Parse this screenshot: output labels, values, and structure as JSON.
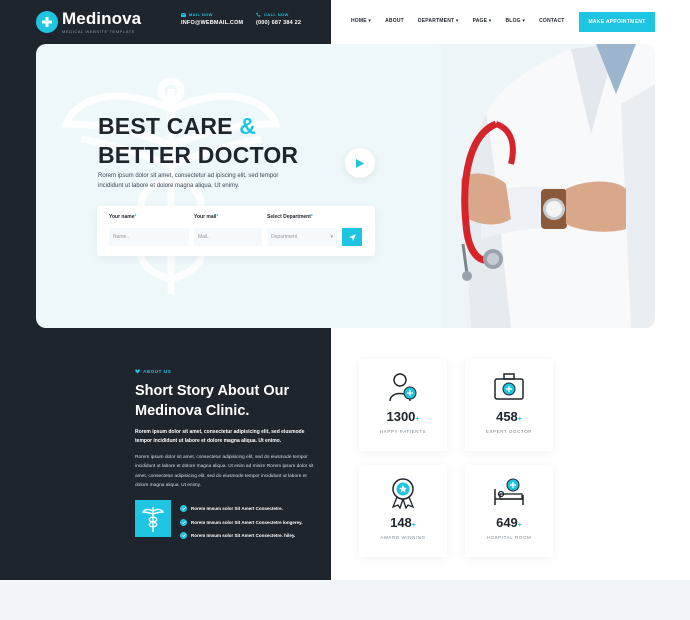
{
  "brand": {
    "name": "Medinova",
    "tagline": "MEDICAL WEBSITE TEMPLATE"
  },
  "header": {
    "mail": {
      "label": "MAIL NOW",
      "value": "INFO@WEBMAIL.COM"
    },
    "call": {
      "label": "CALL NOW",
      "value": "(000) 687 384 22"
    },
    "nav": [
      "HOME",
      "ABOUT",
      "DEPARTMENT",
      "PAGE",
      "BLOG",
      "CONTACT"
    ],
    "cta": "MAKE APPOINTMENT"
  },
  "hero": {
    "title_line1": "BEST CARE",
    "title_amp": "&",
    "title_line2": "BETTER DOCTOR",
    "text": "Rorem ipsum dolor sit amet, consectetur ad ipiscing elit, sed tempor incididunt ut labore et dolore magna aliqua. Ut enimy.",
    "form": {
      "name_label": "Your name",
      "name_placeholder": "Name..",
      "mail_label": "Your mail",
      "mail_placeholder": "Mail..",
      "dept_label": "Select Department",
      "dept_value": "Department"
    }
  },
  "about": {
    "label": "ABOUT US",
    "title_line1": "Short Story About Our",
    "title_line2": "Medinova Clinic.",
    "p1": "Rorem ipsum dolor sit amet, consectetur adipisicing elit, sed eiusmode tempor incididunt ut labore et dolore magna aliqua. Ut enimo.",
    "p2": "Rorem ipsum dolor sit amet, consectetur adipisicing elit, sed do eiusmode tempor incididunt ut labore et dolore magna aliqua. Ut enim ad minim Rorem ipsum dolor sit amet, consectetur adipisicing elit, sed do eiusmode tempor incididunt ut labore et dolore magna aliqua. Ut enimy.",
    "checks": [
      "Rorem Imsum solor Sit Amert Consectetre.",
      "Rorem Imsum solor Sit Amert Consectetre longerey.",
      "Rorem Imsum solor Sit Amert Consectetre. hiley."
    ]
  },
  "stats": [
    {
      "num": "1300",
      "plus": "+",
      "label": "HAPPY PATIENTS",
      "icon": "patient-icon"
    },
    {
      "num": "458",
      "plus": "+",
      "label": "EXPERT DOCTOR",
      "icon": "medical-kit-icon"
    },
    {
      "num": "148",
      "plus": "+",
      "label": "AWARD WINNING",
      "icon": "award-icon"
    },
    {
      "num": "649",
      "plus": "+",
      "label": "HOSPITAL ROOM",
      "icon": "hospital-bed-icon"
    }
  ],
  "colors": {
    "accent": "#1ec5e3",
    "dark": "#1f252c",
    "hero_bg": "#eef8fb"
  }
}
